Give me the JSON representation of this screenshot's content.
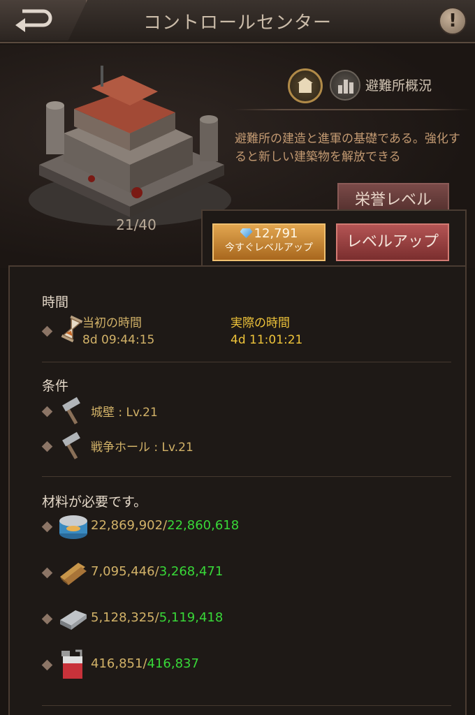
{
  "header": {
    "title": "コントロールセンター",
    "info_symbol": "!"
  },
  "building": {
    "level_count": "21/40",
    "overview_label": "避難所概況",
    "description": "避難所の建造と進軍の基礎である。強化すると新しい建築物を解放できる",
    "honor_button": "栄誉レベル"
  },
  "actions": {
    "instant_gems": "12,791",
    "instant_label": "今すぐレベルアップ",
    "levelup_label": "レベルアップ"
  },
  "time_section": {
    "title": "時間",
    "original_label": "当初の時間",
    "original_value": "8d 09:44:15",
    "actual_label": "実際の時間",
    "actual_value": "4d 11:01:21"
  },
  "conditions": {
    "title": "条件",
    "items": [
      {
        "text": "城壁 : Lv.21",
        "icon": "hammer-icon"
      },
      {
        "text": "戦争ホール : Lv.21",
        "icon": "hammer-icon"
      }
    ]
  },
  "materials": {
    "title": "材料が必要です。",
    "items": [
      {
        "icon": "food-can-icon",
        "owned": "22,869,902",
        "required": "22,860,618"
      },
      {
        "icon": "wood-icon",
        "owned": "7,095,446",
        "required": "3,268,471"
      },
      {
        "icon": "steel-icon",
        "owned": "5,128,325",
        "required": "5,119,418"
      },
      {
        "icon": "fuel-can-icon",
        "owned": "416,851",
        "required": "416,837"
      }
    ]
  },
  "colors": {
    "accent_gold": "#d2b268",
    "requirement_met": "#38d838",
    "levelup_red": "#b45454",
    "instant_orange": "#e2a650"
  }
}
